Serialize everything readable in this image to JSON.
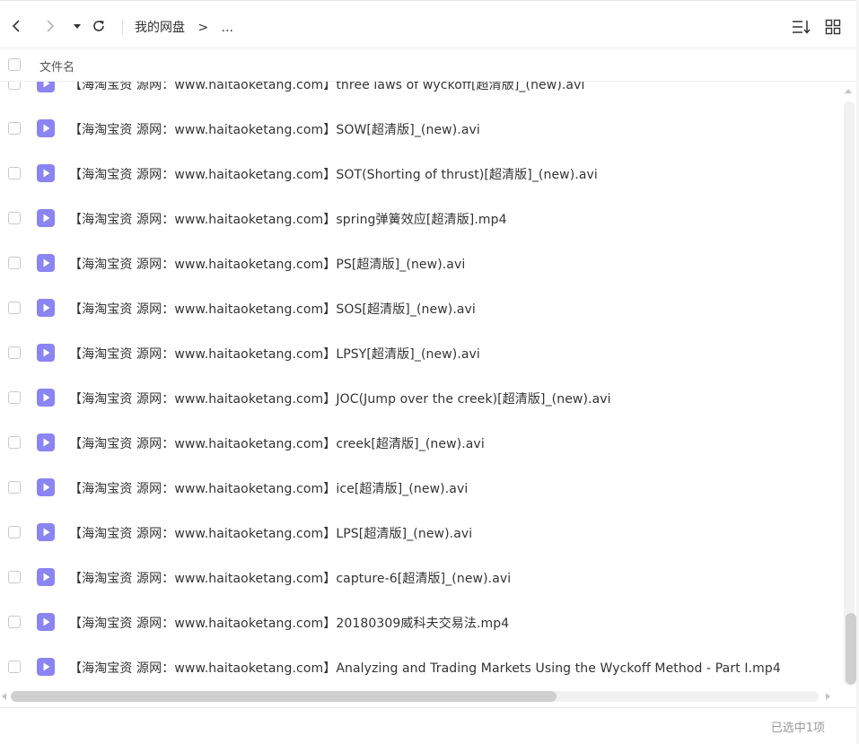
{
  "toolbar": {
    "breadcrumb_root": "我的网盘",
    "breadcrumb_separator": ">",
    "breadcrumb_more": "..."
  },
  "column_header": {
    "name": "文件名"
  },
  "files": [
    {
      "name": "【海淘宝资 源网：www.haitaoketang.com】three laws of wyckoff[超清版]_(new).avi",
      "type": "video"
    },
    {
      "name": "【海淘宝资 源网：www.haitaoketang.com】SOW[超清版]_(new).avi",
      "type": "video"
    },
    {
      "name": "【海淘宝资 源网：www.haitaoketang.com】SOT(Shorting of thrust)[超清版]_(new).avi",
      "type": "video"
    },
    {
      "name": "【海淘宝资 源网：www.haitaoketang.com】spring弹簧效应[超清版].mp4",
      "type": "video"
    },
    {
      "name": "【海淘宝资 源网：www.haitaoketang.com】PS[超清版]_(new).avi",
      "type": "video"
    },
    {
      "name": "【海淘宝资 源网：www.haitaoketang.com】SOS[超清版]_(new).avi",
      "type": "video"
    },
    {
      "name": "【海淘宝资 源网：www.haitaoketang.com】LPSY[超清版]_(new).avi",
      "type": "video"
    },
    {
      "name": "【海淘宝资 源网：www.haitaoketang.com】JOC(Jump over the creek)[超清版]_(new).avi",
      "type": "video"
    },
    {
      "name": "【海淘宝资 源网：www.haitaoketang.com】creek[超清版]_(new).avi",
      "type": "video"
    },
    {
      "name": "【海淘宝资 源网：www.haitaoketang.com】ice[超清版]_(new).avi",
      "type": "video"
    },
    {
      "name": "【海淘宝资 源网：www.haitaoketang.com】LPS[超清版]_(new).avi",
      "type": "video"
    },
    {
      "name": "【海淘宝资 源网：www.haitaoketang.com】capture-6[超清版]_(new).avi",
      "type": "video"
    },
    {
      "name": "【海淘宝资 源网：www.haitaoketang.com】20180309威科夫交易法.mp4",
      "type": "video"
    },
    {
      "name": "【海淘宝资 源网：www.haitaoketang.com】Analyzing and Trading Markets Using the Wyckoff Method - Part I.mp4",
      "type": "video"
    }
  ],
  "status": {
    "selection": "已选中1项"
  },
  "colors": {
    "file_icon": "#8b84f2",
    "file_icon_play": "#ffffff",
    "text": "#333333",
    "muted": "#999999"
  },
  "icons": {
    "back": "chevron-left-icon",
    "forward": "chevron-right-icon",
    "dropdown": "caret-down-icon",
    "refresh": "refresh-icon",
    "sort": "sort-icon",
    "grid": "grid-view-icon",
    "file": "video-file-icon"
  }
}
